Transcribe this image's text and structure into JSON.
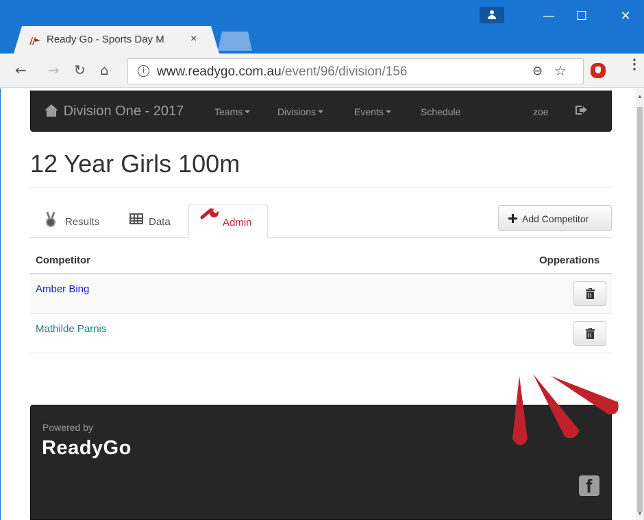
{
  "browser": {
    "tab_title": "Ready Go - Sports Day M",
    "tab_close": "×",
    "url_host": "www.readygo.com.au",
    "url_path": "/event/96/division/156",
    "info_glyph": "i",
    "window_controls": {
      "minimize": "—",
      "maximize": "☐",
      "close": "✕"
    },
    "nav": {
      "back": "←",
      "forward": "→",
      "reload": "↻",
      "home": "⌂"
    },
    "zoom_glyph": "⊖",
    "star_glyph": "☆",
    "menu_glyph": "⋮"
  },
  "navbar": {
    "brand": "Division One - 2017",
    "items": [
      {
        "label": "Teams",
        "dropdown": true
      },
      {
        "label": "Divisions",
        "dropdown": true
      },
      {
        "label": "Events",
        "dropdown": true
      },
      {
        "label": "Schedule",
        "dropdown": false
      }
    ],
    "user": "zoe"
  },
  "page": {
    "title": "12 Year Girls 100m"
  },
  "tabs": [
    {
      "label": "Results",
      "icon": "medal-icon",
      "active": false
    },
    {
      "label": "Data",
      "icon": "table-icon",
      "active": false
    },
    {
      "label": "Admin",
      "icon": "wrench-icon",
      "active": true
    }
  ],
  "add_competitor_label": "Add Competitor",
  "table": {
    "headers": {
      "competitor": "Competitor",
      "operations": "Opperations"
    },
    "rows": [
      {
        "name": "Amber Bing",
        "color": "#1a1acc"
      },
      {
        "name": "Mathilde Parnis",
        "color": "#23807a"
      }
    ]
  },
  "footer": {
    "powered_by": "Powered by",
    "logo": "ReadyGo"
  },
  "colors": {
    "chrome_blue": "#1a76d2",
    "navbar_bg": "#262626",
    "accent_red": "#c0222c"
  }
}
